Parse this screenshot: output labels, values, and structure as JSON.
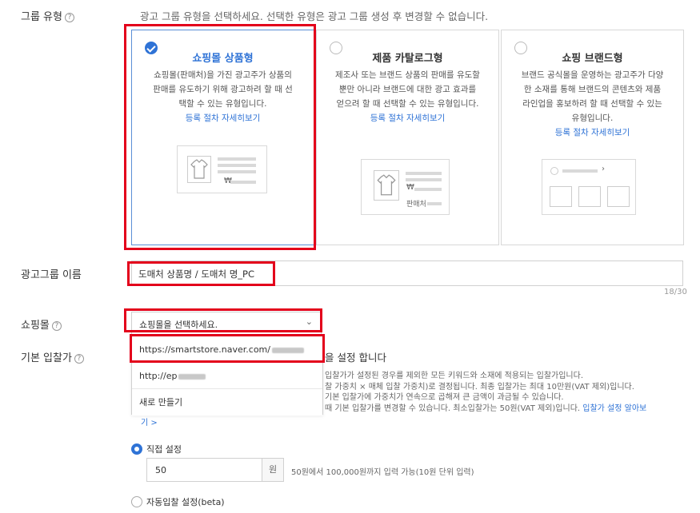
{
  "group_type": {
    "label": "그룹 유형",
    "help": "?",
    "description": "광고 그룹 유형을 선택하세요. 선택한 유형은 광고 그룹 생성 후 변경할 수 없습니다.",
    "cards": [
      {
        "title": "쇼핑몰 상품형",
        "desc": "쇼핑몰(판매처)을 가진 광고주가 상품의 판매를 유도하기 위해 광고하려 할 때 선택할 수 있는 유형입니다.",
        "link": "등록 절차 자세히보기",
        "mock_price": "₩"
      },
      {
        "title": "제품 카탈로그형",
        "desc": "제조사 또는 브랜드 상품의 판매를 유도할 뿐만 아니라 브랜드에 대한 광고 효과를 얻으려 할 때 선택할 수 있는 유형입니다.",
        "link": "등록 절차 자세히보기",
        "mock_price": "₩",
        "mock_seller": "판매처"
      },
      {
        "title": "쇼핑 브랜드형",
        "desc": "브랜드 공식몰을 운영하는 광고주가 다양한 소재를 통해 브랜드의 콘텐츠와 제품 라인업을 홍보하려 할 때 선택할 수 있는 유형입니다.",
        "link": "등록 절차 자세히보기"
      }
    ]
  },
  "group_name": {
    "label": "광고그룹 이름",
    "value": "도매처 상품명 / 도매처 명_PC",
    "counter": "18/30"
  },
  "shopping_mall": {
    "label": "쇼핑몰",
    "help": "?",
    "placeholder": "쇼핑몰을 선택하세요.",
    "options": [
      "https://smartstore.naver.com/",
      "http://ep",
      "새로 만들기"
    ]
  },
  "base_bid": {
    "label": "기본 입찰가",
    "help": "?",
    "heading_tail": "을 설정 합니다",
    "lines": [
      "입찰가가 설정된 경우를 제외한 모든 키워드와 소재에 적용되는 입찰가입니다.",
      "찰 가중치 × 매체 입찰 가중치)로 결정됩니다. 최종 입찰가는 최대 10만원(VAT 제외)입니다.",
      "기본 입찰가에 가중치가 연속으로 곱해져 큰 금액이 과금될 수 있습니다.",
      "때 기본 입찰가를 변경할 수 있습니다. 최소입찰가는 50원(VAT 제외)입니다."
    ],
    "link_a": "입찰가 설정 알아보",
    "link_b": "기 >",
    "manual_label": "직접 설정",
    "amount": "50",
    "unit": "원",
    "range_hint": "50원에서 100,000원까지 입력 가능(10원 단위 입력)",
    "auto_label": "자동입찰 설정(beta)"
  }
}
